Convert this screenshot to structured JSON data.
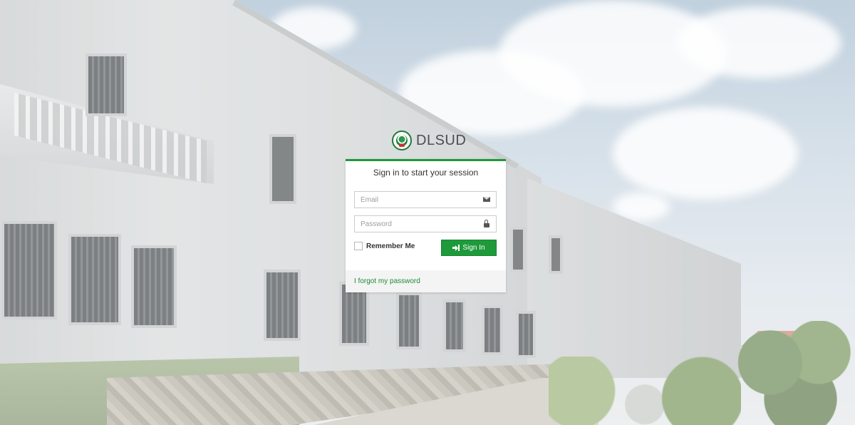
{
  "logo": {
    "text": "DLSUD",
    "icon": "seal-icon"
  },
  "login_box": {
    "message": "Sign in to start your session",
    "email": {
      "placeholder": "Email",
      "value": "",
      "icon": "envelope-icon"
    },
    "password": {
      "placeholder": "Password",
      "value": "",
      "icon": "lock-icon"
    },
    "remember_label": "Remember Me",
    "signin_label": "Sign In",
    "signin_icon": "sign-in-icon",
    "forgot_link": "I forgot my password"
  },
  "colors": {
    "accent": "#1e9a3a",
    "link": "#1e8a3a"
  }
}
